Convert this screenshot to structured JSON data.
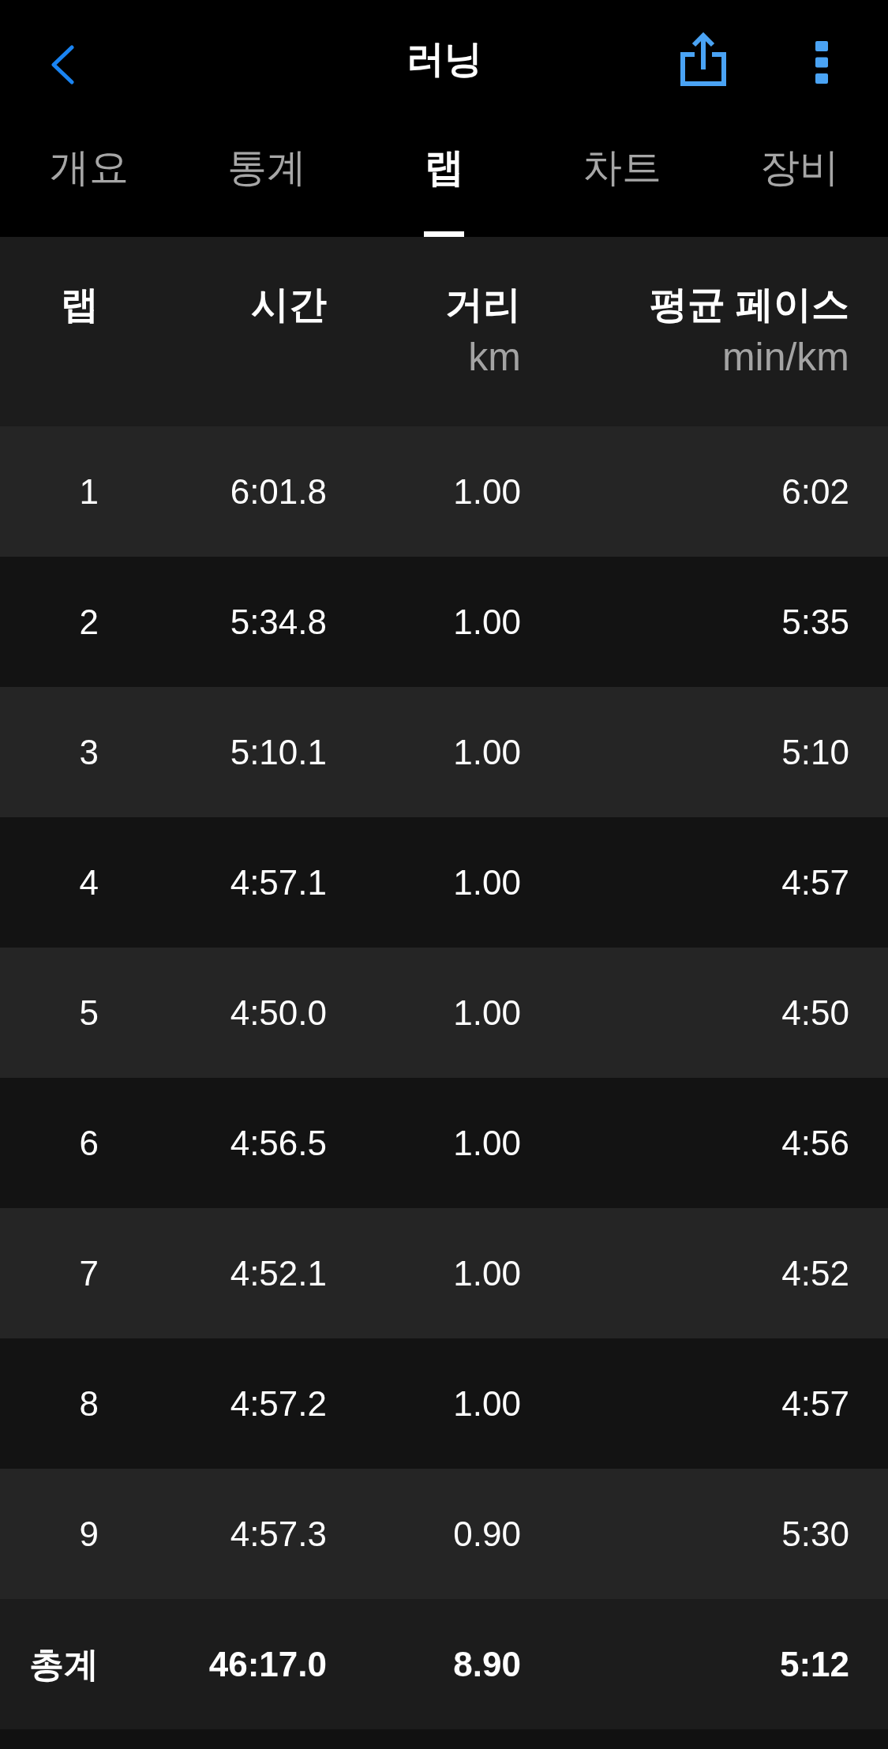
{
  "nav": {
    "title": "러닝"
  },
  "tabs": [
    {
      "label": "개요",
      "selected": false
    },
    {
      "label": "통계",
      "selected": false
    },
    {
      "label": "랩",
      "selected": true
    },
    {
      "label": "차트",
      "selected": false
    },
    {
      "label": "장비",
      "selected": false
    }
  ],
  "table": {
    "columns": [
      {
        "label": "랩"
      },
      {
        "label": "시간"
      },
      {
        "label": "거리",
        "unit": "km"
      },
      {
        "label": "평균 페이스",
        "unit": "min/km"
      }
    ],
    "rows": [
      [
        "1",
        "6:01.8",
        "1.00",
        "6:02"
      ],
      [
        "2",
        "5:34.8",
        "1.00",
        "5:35"
      ],
      [
        "3",
        "5:10.1",
        "1.00",
        "5:10"
      ],
      [
        "4",
        "4:57.1",
        "1.00",
        "4:57"
      ],
      [
        "5",
        "4:50.0",
        "1.00",
        "4:50"
      ],
      [
        "6",
        "4:56.5",
        "1.00",
        "4:56"
      ],
      [
        "7",
        "4:52.1",
        "1.00",
        "4:52"
      ],
      [
        "8",
        "4:57.2",
        "1.00",
        "4:57"
      ],
      [
        "9",
        "4:57.3",
        "0.90",
        "5:30"
      ]
    ],
    "total": [
      "총계",
      "46:17.0",
      "8.90",
      "5:12"
    ]
  }
}
